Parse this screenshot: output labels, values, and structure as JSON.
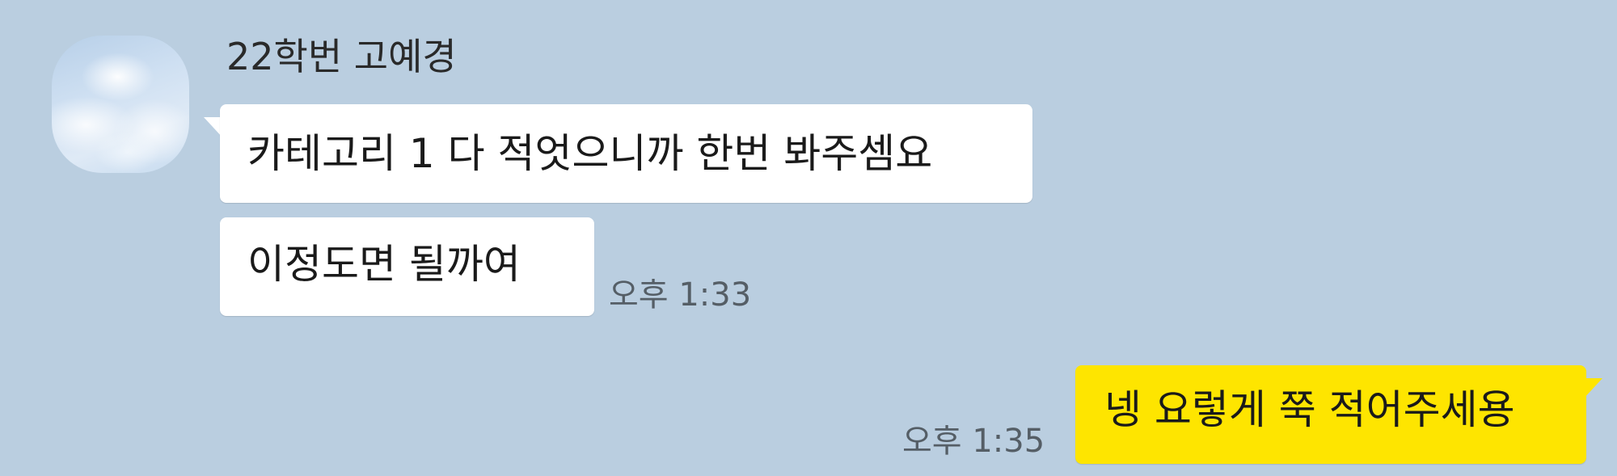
{
  "chat": {
    "incoming": {
      "sender_name": "22학번 고예경",
      "avatar_icon": "sky-cloud-profile-photo",
      "messages": [
        {
          "text": "카테고리 1 다 적엇으니까 한번 봐주셈요"
        },
        {
          "text": "이정도면 될까여",
          "time": "오후 1:33"
        }
      ]
    },
    "outgoing": {
      "messages": [
        {
          "text": "넹 요렇게 쭉 적어주세용",
          "time": "오후 1:35"
        }
      ]
    }
  },
  "colors": {
    "background": "#bacee0",
    "incoming_bubble": "#ffffff",
    "outgoing_bubble": "#fee500",
    "timestamp": "#555e66"
  }
}
